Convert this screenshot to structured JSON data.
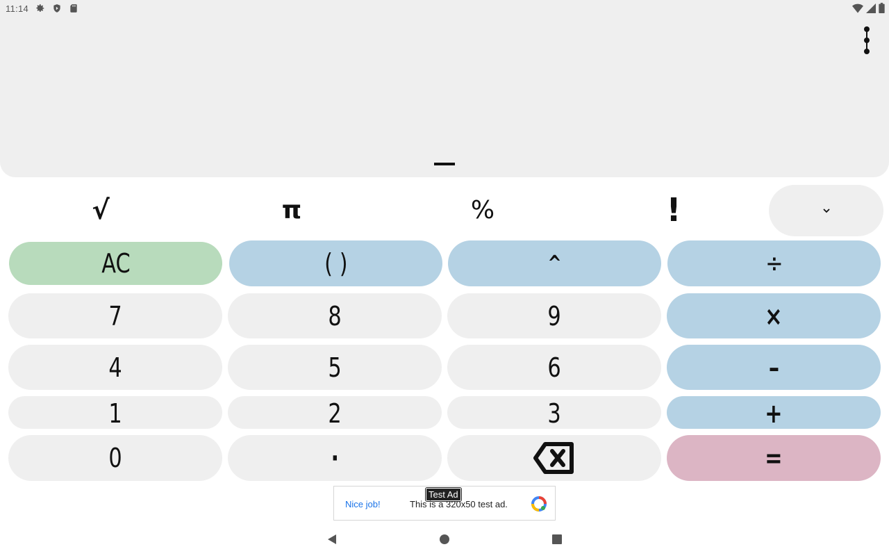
{
  "status_bar": {
    "time": "11:14",
    "left_icons": [
      "gear-icon",
      "shield-icon",
      "sd-card-icon"
    ],
    "right_icons": [
      "wifi-icon",
      "signal-icon",
      "battery-icon"
    ]
  },
  "display": {
    "expression": "",
    "result": ""
  },
  "scientific": {
    "keys": [
      "√",
      "π",
      "%",
      "!"
    ]
  },
  "keypad": {
    "ac": "AC",
    "parens": "( )",
    "power": "^",
    "divide": "÷",
    "seven": "7",
    "eight": "8",
    "nine": "9",
    "multiply": "×",
    "four": "4",
    "five": "5",
    "six": "6",
    "minus": "–",
    "one": "1",
    "two": "2",
    "three": "3",
    "plus": "+",
    "zero": "0",
    "dot": "·",
    "equals": "="
  },
  "ad": {
    "tag": "Test Ad",
    "headline": "Nice job!",
    "body": "This is a 320x50 test ad."
  },
  "colors": {
    "number_key": "#efefef",
    "operator_key": "#b5d2e4",
    "clear_key": "#b8dbbc",
    "equals_key": "#dcb5c4"
  }
}
